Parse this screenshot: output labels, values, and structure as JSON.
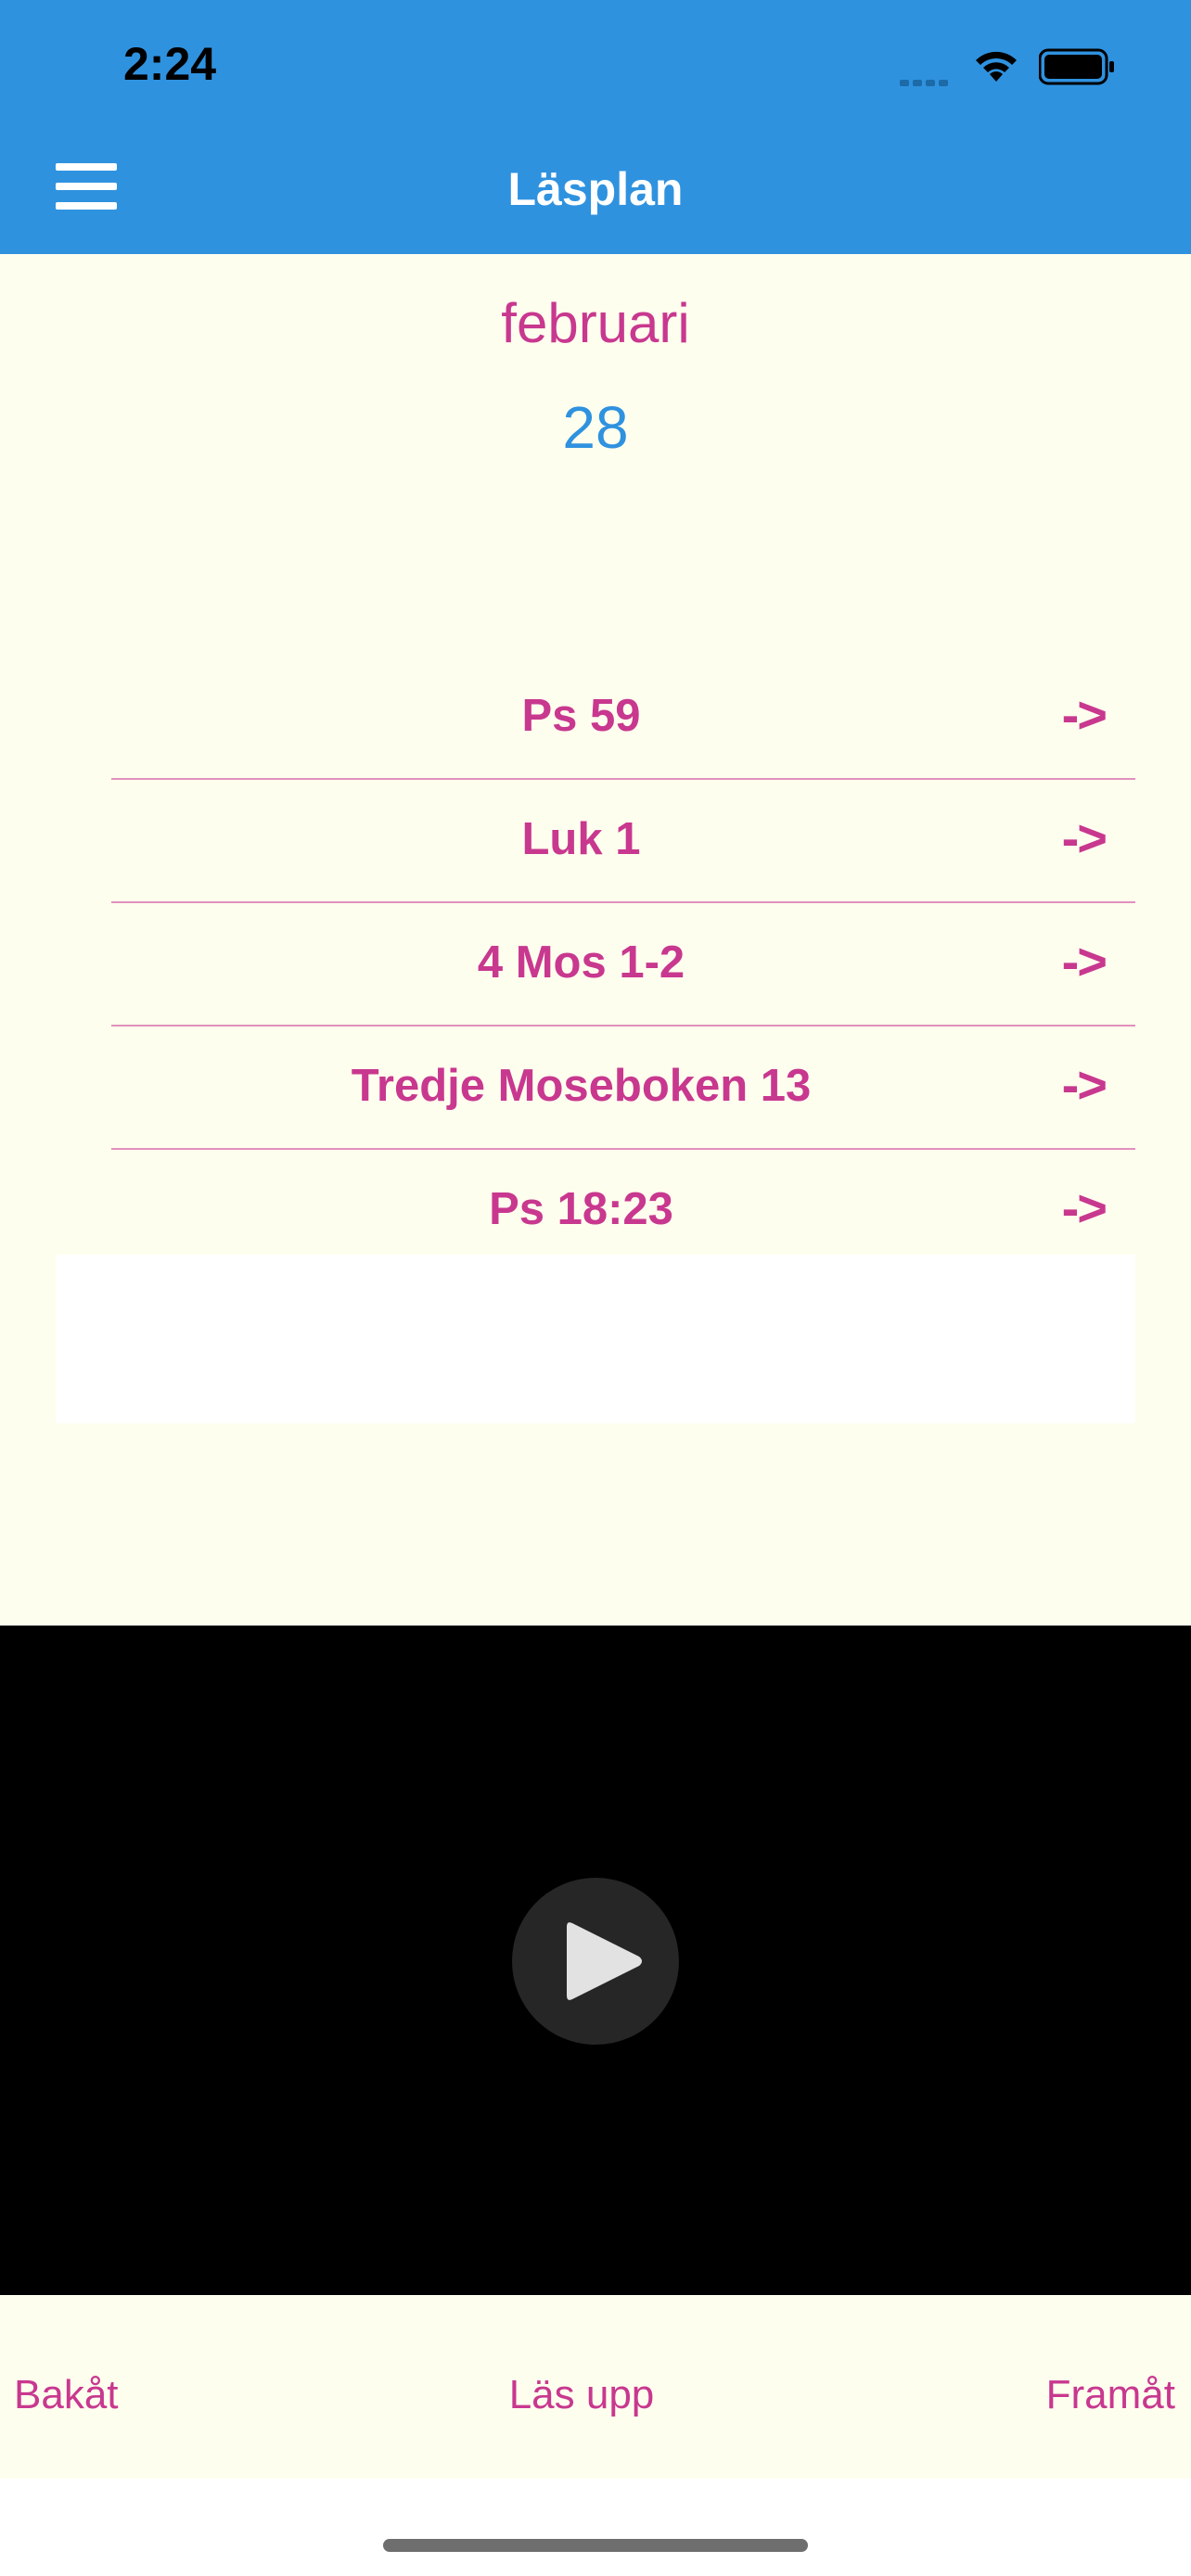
{
  "status_bar": {
    "time": "2:24"
  },
  "nav": {
    "title": "Läsplan"
  },
  "date": {
    "month": "februari",
    "day": "28"
  },
  "readings": [
    {
      "label": "Ps 59",
      "arrow": "->"
    },
    {
      "label": "Luk 1",
      "arrow": "->"
    },
    {
      "label": "4 Mos 1-2",
      "arrow": "->"
    },
    {
      "label": "Tredje Moseboken 13",
      "arrow": "->"
    },
    {
      "label": "Ps 18:23",
      "arrow": "->"
    }
  ],
  "bottom_bar": {
    "back_label": "Bakåt",
    "read_label": "Läs upp",
    "forward_label": "Framåt"
  },
  "colors": {
    "header": "#2f92df",
    "accent": "#c8388f",
    "content_bg": "#fefeee",
    "day_color": "#2f92df"
  },
  "icons": [
    "menu-icon",
    "wifi-icon",
    "battery-icon",
    "signal-icon",
    "play-icon"
  ]
}
